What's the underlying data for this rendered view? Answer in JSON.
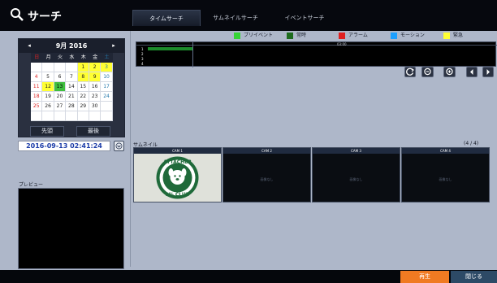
{
  "header": {
    "title": "サーチ",
    "tabs": [
      {
        "label": "タイムサーチ",
        "active": true
      },
      {
        "label": "サムネイルサーチ",
        "active": false
      },
      {
        "label": "イベントサーチ",
        "active": false
      }
    ]
  },
  "calendar": {
    "month_label": "9月 2016",
    "weekdays": [
      "日",
      "月",
      "火",
      "水",
      "木",
      "金",
      "土"
    ],
    "weeks": [
      [
        "",
        "",
        "",
        "",
        "1",
        "2",
        "3"
      ],
      [
        "4",
        "5",
        "6",
        "7",
        "8",
        "9",
        "10"
      ],
      [
        "11",
        "12",
        "13",
        "14",
        "15",
        "16",
        "17"
      ],
      [
        "18",
        "19",
        "20",
        "21",
        "22",
        "23",
        "24"
      ],
      [
        "25",
        "26",
        "27",
        "28",
        "29",
        "30",
        ""
      ],
      [
        "",
        "",
        "",
        "",
        "",
        "",
        ""
      ]
    ],
    "recorded_days": [
      "1",
      "2",
      "3",
      "8",
      "9",
      "12"
    ],
    "selected_day": "13",
    "first_button": "先頭",
    "last_button": "最後"
  },
  "datetime": "2016-09-13  02:41:24",
  "preview_label": "プレビュー",
  "legend": [
    {
      "label": "プリイベント",
      "color": "#35d435"
    },
    {
      "label": "常時",
      "color": "#1d6b1d"
    },
    {
      "label": "アラーム",
      "color": "#e02020"
    },
    {
      "label": "モーション",
      "color": "#1ea0ff"
    },
    {
      "label": "緊急",
      "color": "#ffff33"
    }
  ],
  "timeline": {
    "time_label": "03:00",
    "channels": [
      "1",
      "2",
      "3",
      "4"
    ]
  },
  "controls": {
    "refresh_icon": "refresh-icon",
    "zoom_out_icon": "zoom-out-icon",
    "zoom_in_icon": "zoom-in-icon",
    "prev_icon": "arrow-left-icon",
    "next_icon": "arrow-right-icon"
  },
  "thumbnails": {
    "label": "サムネイル",
    "count": "(4 / 4)",
    "cams": [
      {
        "name": "CAM 1",
        "content": "image",
        "logo_top": "ATTACHER",
        "logo_bottom": "1% CLUB"
      },
      {
        "name": "CAM 2",
        "content": "nodata",
        "nodata_text": "画像なし"
      },
      {
        "name": "CAM 3",
        "content": "nodata",
        "nodata_text": "画像なし"
      },
      {
        "name": "CAM 4",
        "content": "nodata",
        "nodata_text": "画像なし"
      }
    ]
  },
  "footer": {
    "play": "再生",
    "close": "閉じる"
  }
}
